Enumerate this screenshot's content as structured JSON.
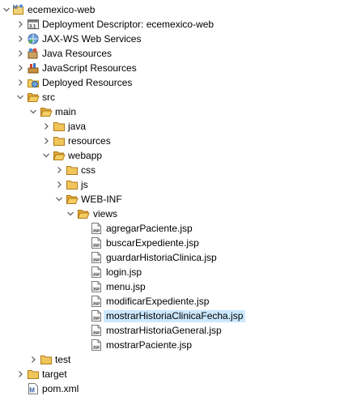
{
  "tree": {
    "items": [
      {
        "label": "ecemexico-web",
        "icon": "maven-project-icon",
        "expanded": true
      },
      {
        "label": "Deployment Descriptor: ecemexico-web",
        "icon": "deployment-descriptor-icon",
        "expanded": false
      },
      {
        "label": "JAX-WS Web Services",
        "icon": "web-services-icon",
        "expanded": false
      },
      {
        "label": "Java Resources",
        "icon": "java-resources-icon",
        "expanded": false
      },
      {
        "label": "JavaScript Resources",
        "icon": "javascript-resources-icon",
        "expanded": false
      },
      {
        "label": "Deployed Resources",
        "icon": "deployed-resources-icon",
        "expanded": false
      },
      {
        "label": "src",
        "icon": "folder-icon",
        "expanded": true
      },
      {
        "label": "main",
        "icon": "folder-icon",
        "expanded": true
      },
      {
        "label": "java",
        "icon": "folder-icon",
        "expanded": false
      },
      {
        "label": "resources",
        "icon": "folder-icon",
        "expanded": false
      },
      {
        "label": "webapp",
        "icon": "folder-icon",
        "expanded": true
      },
      {
        "label": "css",
        "icon": "folder-icon",
        "expanded": false
      },
      {
        "label": "js",
        "icon": "folder-icon",
        "expanded": false
      },
      {
        "label": "WEB-INF",
        "icon": "folder-icon",
        "expanded": true
      },
      {
        "label": "views",
        "icon": "folder-icon",
        "expanded": true
      },
      {
        "label": "agregarPaciente.jsp",
        "icon": "jsp-file-icon"
      },
      {
        "label": "buscarExpediente.jsp",
        "icon": "jsp-file-icon"
      },
      {
        "label": "guardarHistoriaClinica.jsp",
        "icon": "jsp-file-icon"
      },
      {
        "label": "login.jsp",
        "icon": "jsp-file-icon"
      },
      {
        "label": "menu.jsp",
        "icon": "jsp-file-icon"
      },
      {
        "label": "modificarExpediente.jsp",
        "icon": "jsp-file-icon"
      },
      {
        "label": "mostrarHistoriaClinicaFecha.jsp",
        "icon": "jsp-file-icon",
        "selected": true
      },
      {
        "label": "mostrarHistoriaGeneral.jsp",
        "icon": "jsp-file-icon"
      },
      {
        "label": "mostrarPaciente.jsp",
        "icon": "jsp-file-icon"
      },
      {
        "label": "test",
        "icon": "folder-icon",
        "expanded": false
      },
      {
        "label": "target",
        "icon": "folder-icon",
        "expanded": false
      },
      {
        "label": "pom.xml",
        "icon": "maven-pom-icon"
      }
    ]
  },
  "colors": {
    "selection": "#cce8ff",
    "folder": "#e8b73a",
    "chevron": "#555555"
  }
}
